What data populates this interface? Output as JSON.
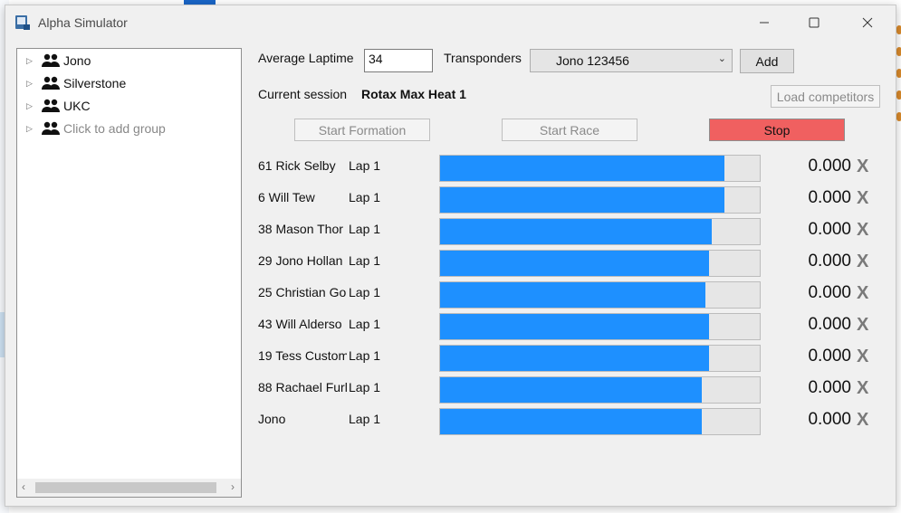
{
  "window": {
    "title": "Alpha Simulator"
  },
  "tree": {
    "items": [
      {
        "label": "Jono",
        "placeholder": false
      },
      {
        "label": "Silverstone",
        "placeholder": false
      },
      {
        "label": "UKC",
        "placeholder": false
      },
      {
        "label": "Click to add group",
        "placeholder": true
      }
    ]
  },
  "controls": {
    "avg_laptime_label": "Average Laptime",
    "avg_laptime_value": "34",
    "transponders_label": "Transponders",
    "transponder_selected": "Jono 123456",
    "add_label": "Add",
    "current_session_label": "Current session",
    "current_session_value": "Rotax Max Heat 1",
    "load_competitors_label": "Load competitors",
    "start_formation_label": "Start Formation",
    "start_race_label": "Start Race",
    "stop_label": "Stop"
  },
  "colors": {
    "progress": "#1e90ff",
    "stop": "#f06060"
  },
  "racers": [
    {
      "name": "61 Rick Selby",
      "lap": "Lap 1",
      "progress": 0.89,
      "time": "0.000",
      "remove": "X"
    },
    {
      "name": "6 Will Tew",
      "lap": "Lap 1",
      "progress": 0.89,
      "time": "0.000",
      "remove": "X"
    },
    {
      "name": "38 Mason Thor",
      "lap": "Lap 1",
      "progress": 0.85,
      "time": "0.000",
      "remove": "X"
    },
    {
      "name": "29 Jono Hollan",
      "lap": "Lap 1",
      "progress": 0.84,
      "time": "0.000",
      "remove": "X"
    },
    {
      "name": "25 Christian Go",
      "lap": "Lap 1",
      "progress": 0.83,
      "time": "0.000",
      "remove": "X"
    },
    {
      "name": "43 Will Alderso",
      "lap": "Lap 1",
      "progress": 0.84,
      "time": "0.000",
      "remove": "X"
    },
    {
      "name": "19 Tess Custom",
      "lap": "Lap 1",
      "progress": 0.84,
      "time": "0.000",
      "remove": "X"
    },
    {
      "name": "88 Rachael Furl",
      "lap": "Lap 1",
      "progress": 0.82,
      "time": "0.000",
      "remove": "X"
    },
    {
      "name": "Jono",
      "lap": "Lap 1",
      "progress": 0.82,
      "time": "0.000",
      "remove": "X"
    }
  ]
}
